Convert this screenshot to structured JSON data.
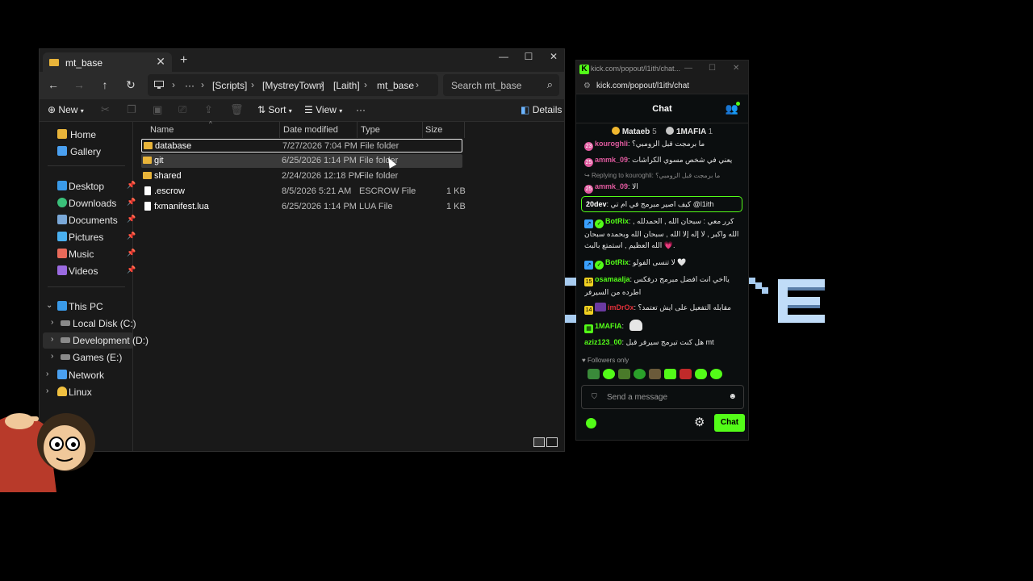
{
  "explorer": {
    "tab_title": "mt_base",
    "tab_close": "✕",
    "new_tab": "+",
    "window": {
      "minimize": "—",
      "maximize": "☐",
      "close": "✕"
    },
    "nav": {
      "back": "←",
      "forward": "→",
      "up": "↑",
      "refresh": "↻"
    },
    "breadcrumb": [
      "[Scripts]",
      "[MystreyTown]",
      "[Laith]",
      "mt_base"
    ],
    "more": "···",
    "search_placeholder": "Search mt_base",
    "toolbar": {
      "new": "New",
      "sort": "Sort",
      "view": "View",
      "more": "···",
      "details": "Details"
    },
    "sidebar": {
      "quick": [
        {
          "label": "Home",
          "icon": "home-icon"
        },
        {
          "label": "Gallery",
          "icon": "gallery-icon"
        }
      ],
      "pinned": [
        {
          "label": "Desktop",
          "icon": "desktop-icon"
        },
        {
          "label": "Downloads",
          "icon": "download-icon"
        },
        {
          "label": "Documents",
          "icon": "documents-icon"
        },
        {
          "label": "Pictures",
          "icon": "pictures-icon"
        },
        {
          "label": "Music",
          "icon": "music-icon"
        },
        {
          "label": "Videos",
          "icon": "videos-icon"
        }
      ],
      "tree": [
        {
          "label": "This PC",
          "icon": "pc-icon"
        },
        {
          "label": "Local Disk (C:)",
          "icon": "drive-icon"
        },
        {
          "label": "Development (D:)",
          "icon": "drive-icon"
        },
        {
          "label": "Games (E:)",
          "icon": "drive-icon"
        },
        {
          "label": "Network",
          "icon": "network-icon"
        },
        {
          "label": "Linux",
          "icon": "linux-icon"
        }
      ]
    },
    "columns": {
      "name": "Name",
      "date": "Date modified",
      "type": "Type",
      "size": "Size"
    },
    "files": [
      {
        "name": "database",
        "date": "7/27/2026 7:04 PM",
        "type": "File folder",
        "size": "",
        "kind": "folder"
      },
      {
        "name": "git",
        "date": "6/25/2026 1:14 PM",
        "type": "File folder",
        "size": "",
        "kind": "folder"
      },
      {
        "name": "shared",
        "date": "2/24/2026 12:18 PM",
        "type": "File folder",
        "size": "",
        "kind": "folder"
      },
      {
        "name": ".escrow",
        "date": "8/5/2026 5:21 AM",
        "type": "ESCROW File",
        "size": "1 KB",
        "kind": "file"
      },
      {
        "name": "fxmanifest.lua",
        "date": "6/25/2026 1:14 PM",
        "type": "LUA File",
        "size": "1 KB",
        "kind": "file"
      }
    ]
  },
  "chat": {
    "window_title": "kick.com/popout/l1ith/chat...",
    "url": "kick.com/popout/l1ith/chat",
    "header": "Chat",
    "gifters": [
      {
        "name": "Mataeb",
        "count": "5"
      },
      {
        "name": "1MAFIA",
        "count": "1"
      }
    ],
    "messages": [
      {
        "badge": "23",
        "user": "kouroghli",
        "color": "#e05a9f",
        "text": "ما برمجت قبل الزومبي؟"
      },
      {
        "badge": "25",
        "user": "ammk_09",
        "color": "#e05a9f",
        "text": "يعني في شخص مسوي الكراشات"
      },
      {
        "reply": "Replying to kouroghli: ما برمجت قبل الزومبي؟"
      },
      {
        "badge": "25",
        "user": "ammk_09",
        "color": "#e05a9f",
        "text": "الا"
      },
      {
        "user": "20dev",
        "color": "#ffffff",
        "text": "كيف اصير مبرمج في ام تي @l1ith"
      },
      {
        "user": "BotRix",
        "color": "#53fc18",
        "text": "كرر معي : سبحان الله , الحمدلله , الله واكبر , لا إله إلا الله , سبحان الله وبحمده سبحان الله العظيم , استمتع بالبث 💗."
      },
      {
        "user": "BotRix",
        "color": "#53fc18",
        "text": "لا تنسى الفولو 🤍"
      },
      {
        "badge": "15",
        "user": "osamaalja",
        "color": "#53fc18",
        "text": "يااخي انت افضل مبرمج درفكس اطرده من السيرفر"
      },
      {
        "badge": "14",
        "user": "imDrOx",
        "color": "#e0303a",
        "text": "مقابله التفعيل على ايش تعتمد؟"
      },
      {
        "user": "1MAFIA",
        "color": "#53fc18",
        "text": ""
      },
      {
        "user": "aziz123_00",
        "color": "#53fc18",
        "text": "هل كنت تبرمج سيرفر قبل mt"
      }
    ],
    "followers_only": "Followers only",
    "input_placeholder": "Send a message",
    "send_label": "Chat",
    "colors": {
      "accent": "#53fc18"
    }
  }
}
